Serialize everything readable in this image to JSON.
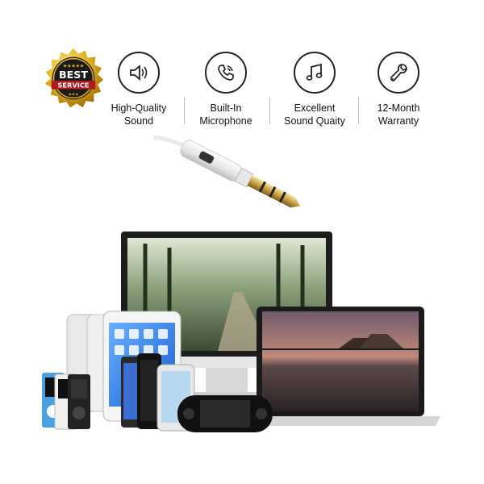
{
  "badge": {
    "line1": "BEST",
    "line2": "SERVICE"
  },
  "features": [
    {
      "icon": "speaker-icon",
      "label": "High-Quality\nSound"
    },
    {
      "icon": "phone-icon",
      "label": "Built-In\nMicrophone"
    },
    {
      "icon": "music-note-icon",
      "label": "Excellent\nSound Quaity"
    },
    {
      "icon": "wrench-icon",
      "label": "12-Month\nWarranty"
    }
  ],
  "colors": {
    "gold": "#d9a520",
    "badge_red": "#b0181c",
    "jack_gold": "#c9a146"
  }
}
